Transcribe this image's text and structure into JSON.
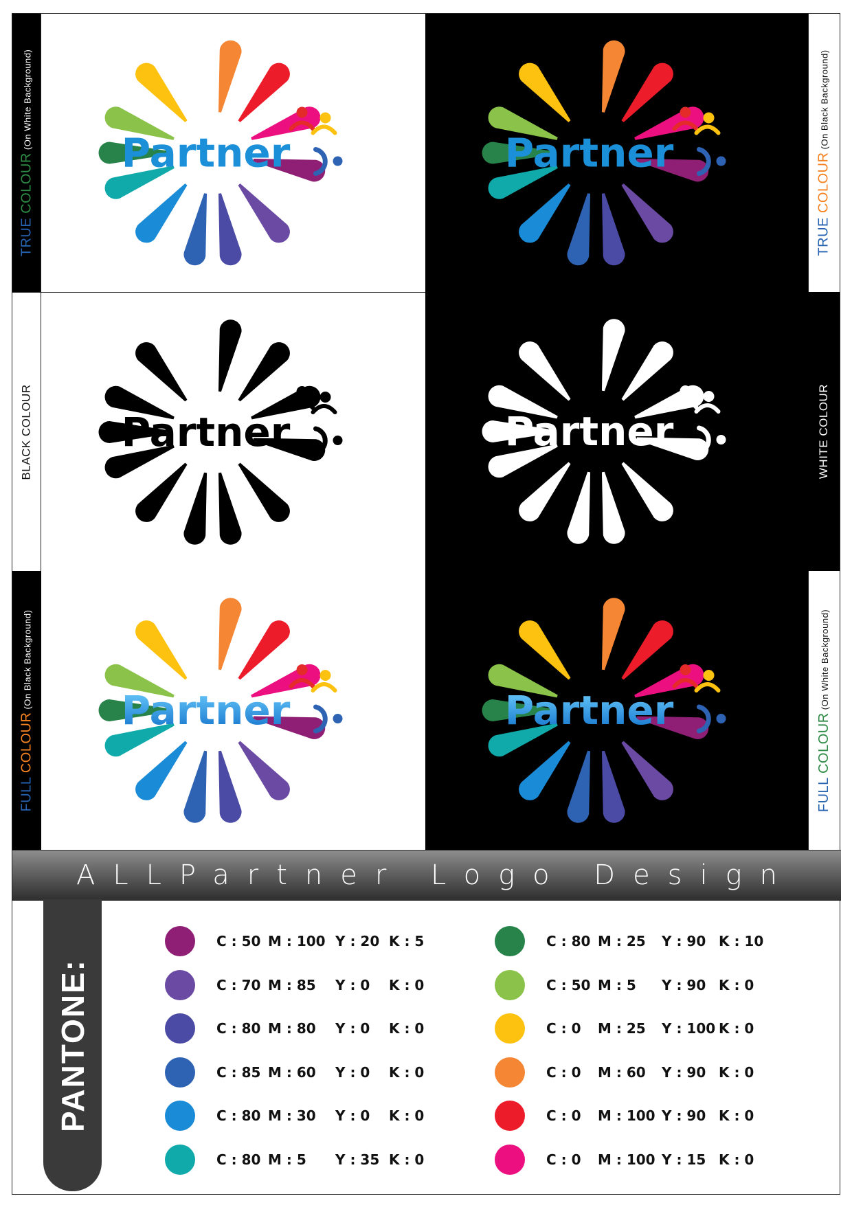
{
  "logo": {
    "word": "Partner"
  },
  "side_labels": {
    "row1_left": {
      "colored_part": [
        {
          "text": "TRUE ",
          "color": "#2563b0"
        },
        {
          "text": "COLOUR",
          "color": "#2e8b45"
        }
      ],
      "suffix": " (On White Background)"
    },
    "row1_right": {
      "colored_part": [
        {
          "text": "TRUE ",
          "color": "#2563b0"
        },
        {
          "text": "COLOUR",
          "color": "#f5821f"
        }
      ],
      "suffix": " (On Black Background)"
    },
    "row2_left": {
      "text": "BLACK COLOUR"
    },
    "row2_right": {
      "text": "WHITE COLOUR"
    },
    "row3_left": {
      "colored_part": [
        {
          "text": "FULL ",
          "color": "#2563b0"
        },
        {
          "text": "COLOUR",
          "color": "#f5821f"
        }
      ],
      "suffix": " (On Black Background)"
    },
    "row3_right": {
      "colored_part": [
        {
          "text": "FULL ",
          "color": "#2563b0"
        },
        {
          "text": "COLOUR",
          "color": "#2e8b45"
        }
      ],
      "suffix": " (On White Background)"
    }
  },
  "banner": {
    "title": "ALLPartner Logo Design"
  },
  "pantone": {
    "label": "PANTONE:",
    "left_column": [
      {
        "color": "#8e1f74",
        "c": "C : 50",
        "m": "M : 100",
        "y": "Y : 20",
        "k": "K : 5"
      },
      {
        "color": "#6a4aa3",
        "c": "C : 70",
        "m": "M : 85",
        "y": "Y : 0",
        "k": "K : 0"
      },
      {
        "color": "#4b4ba6",
        "c": "C : 80",
        "m": "M : 80",
        "y": "Y : 0",
        "k": "K : 0"
      },
      {
        "color": "#2e63b4",
        "c": "C : 85",
        "m": "M : 60",
        "y": "Y : 0",
        "k": "K : 0"
      },
      {
        "color": "#1a8bd6",
        "c": "C : 80",
        "m": "M : 30",
        "y": "Y : 0",
        "k": "K : 0"
      },
      {
        "color": "#11aaaa",
        "c": "C : 80",
        "m": "M : 5",
        "y": "Y : 35",
        "k": "K : 0"
      }
    ],
    "right_column": [
      {
        "color": "#27834a",
        "c": "C : 80",
        "m": "M : 25",
        "y": "Y : 90",
        "k": "K : 10"
      },
      {
        "color": "#8bc34a",
        "c": "C : 50",
        "m": "M : 5",
        "y": "Y : 90",
        "k": "K : 0"
      },
      {
        "color": "#fdc20f",
        "c": "C : 0",
        "m": "M : 25",
        "y": "Y : 100",
        "k": "K : 0"
      },
      {
        "color": "#f58634",
        "c": "C : 0",
        "m": "M : 60",
        "y": "Y : 90",
        "k": "K : 0"
      },
      {
        "color": "#ec1c2b",
        "c": "C : 0",
        "m": "M : 100",
        "y": "Y : 90",
        "k": "K : 0"
      },
      {
        "color": "#ec0f7f",
        "c": "C : 0",
        "m": "M : 100",
        "y": "Y : 15",
        "k": "K : 0"
      }
    ]
  },
  "colors": {
    "petals": [
      "#f58634",
      "#ec1c2b",
      "#ec0f7f",
      "#8e1f74",
      "#6a4aa3",
      "#4b4ba6",
      "#2e63b4",
      "#1a8bd6",
      "#11aaaa",
      "#27834a",
      "#8bc34a",
      "#fdc20f"
    ],
    "wordmark": "#1b8fd8",
    "people": [
      "#e52a2a",
      "#fdc20f"
    ],
    "bracket": "#2e63b4"
  }
}
